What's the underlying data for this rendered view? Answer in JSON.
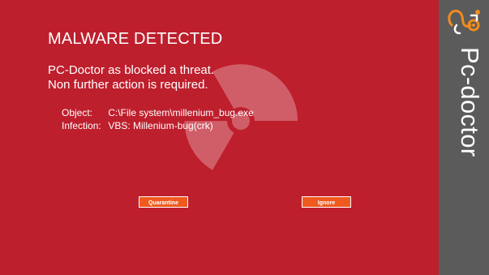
{
  "alert": {
    "title": "MALWARE DETECTED",
    "message_line_1": "PC-Doctor as blocked a threat.",
    "message_line_2": "Non further action is required.",
    "details": {
      "object_label": "Object:",
      "object_value": "C:\\File system\\millenium_bug.exe",
      "infection_label": "Infection:",
      "infection_value": "VBS: Millenium-bug(crk)"
    },
    "buttons": {
      "quarantine_label": "Quarantine",
      "ignore_label": "Ignore"
    },
    "background_icon": "radiation-icon"
  },
  "brand": {
    "name": "Pc-doctor",
    "logo_icon": "stethoscope-icon"
  },
  "colors": {
    "alert_background": "#be1f2d",
    "button_background": "#f05a1f",
    "sidebar_background": "#5b5b5b",
    "logo_accent": "#f28c1e",
    "text": "#ffffff"
  }
}
